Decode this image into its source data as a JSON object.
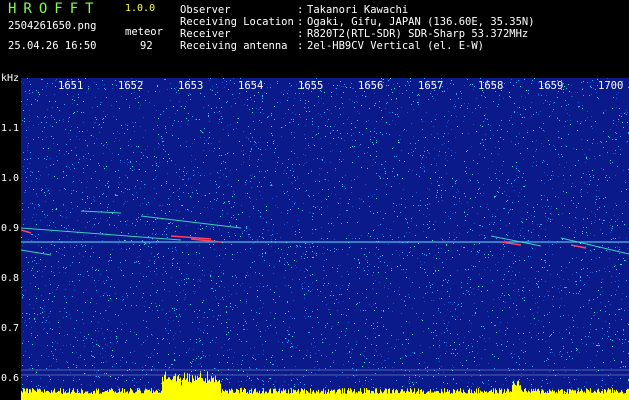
{
  "header": {
    "app_title": "HROFFT",
    "app_version": "1.0.0",
    "file_name": "2504261650.png",
    "date_time": "25.04.26 16:50",
    "meteor_label": "meteor",
    "meteor_count": "92",
    "info": [
      {
        "label": "Observer",
        "value": "Takanori Kawachi"
      },
      {
        "label": "Receiving Location",
        "value": "Ogaki, Gifu, JAPAN (136.60E, 35.35N)"
      },
      {
        "label": "Receiver",
        "value": "R820T2(RTL-SDR) SDR-Sharp 53.372MHz"
      },
      {
        "label": "Receiving antenna",
        "value": "2el-HB9CV Vertical (el. E-W)"
      }
    ],
    "colon": ":"
  },
  "spectrogram": {
    "y_unit": "kHz",
    "time_ticks": [
      "1651",
      "1652",
      "1653",
      "1654",
      "1655",
      "1656",
      "1657",
      "1658",
      "1659",
      "1700"
    ],
    "freq_ticks": [
      "1.1",
      "1.0",
      "0.9",
      "0.8",
      "0.7",
      "0.6"
    ],
    "colors": {
      "background": "#0a1a8a",
      "noise_low": "#1e4dd8",
      "noise_mid": "#3aa0ff",
      "noise_high": "#40e0c0",
      "signal": "#ff4060",
      "carrier": "#60e0ff",
      "bars": "#ffff00",
      "grid": "#ffffff"
    }
  }
}
